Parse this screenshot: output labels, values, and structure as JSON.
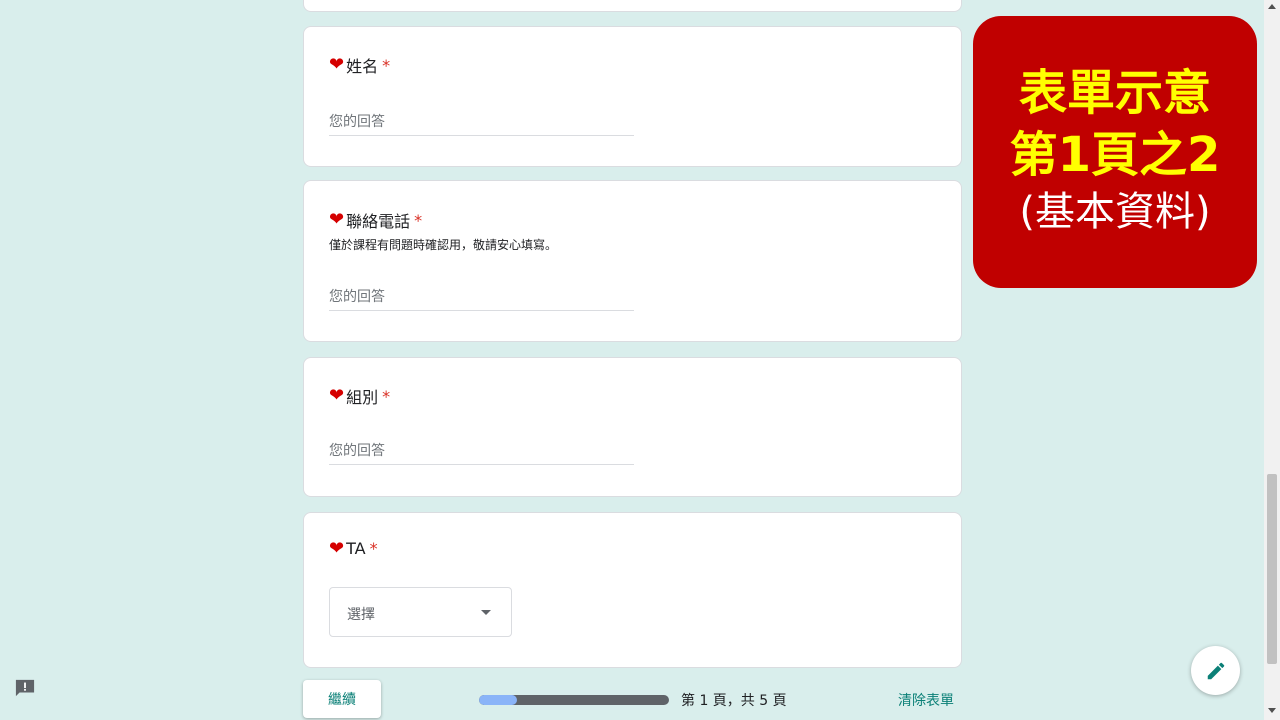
{
  "questions": [
    {
      "title": "姓名",
      "required": "*",
      "description": "",
      "placeholder": "您的回答"
    },
    {
      "title": "聯絡電話",
      "required": "*",
      "description": "僅於課程有問題時確認用，敬請安心填寫。",
      "placeholder": "您的回答"
    },
    {
      "title": "組別",
      "required": "*",
      "description": "",
      "placeholder": "您的回答"
    },
    {
      "title": "TA",
      "required": "*",
      "description": "",
      "placeholder": "選擇"
    }
  ],
  "icons": {
    "question_marker": "heart-icon",
    "dropdown": "dropdown-arrow-icon",
    "fab": "pencil-icon",
    "feedback": "report-issue-icon"
  },
  "footer": {
    "next_label": "繼續",
    "page_indicator": "第 1 頁，共 5 頁",
    "progress_fraction": 0.2,
    "clear_label": "清除表單"
  },
  "overlay": {
    "line1": "表單示意",
    "line2": "第1頁之2",
    "line3": "(基本資料)"
  },
  "colors": {
    "background": "#d9eeec",
    "accent": "#0b8077",
    "required": "#d93025",
    "overlay_bg": "#c00000",
    "overlay_text": "#ffff00"
  }
}
